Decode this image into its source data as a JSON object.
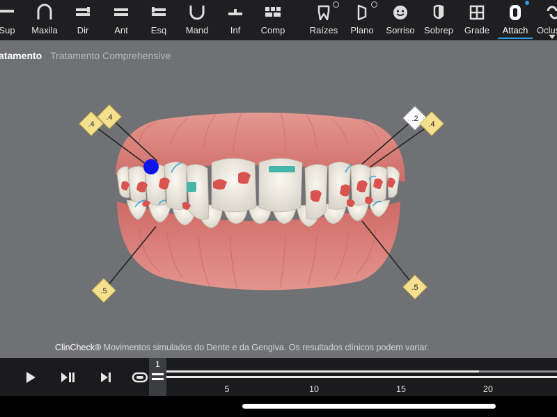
{
  "toolbar": {
    "items": [
      {
        "label": "Sup",
        "icon": "upper-jaw-view-icon"
      },
      {
        "label": "Maxila",
        "icon": "maxilla-icon"
      },
      {
        "label": "Dir",
        "icon": "right-view-icon"
      },
      {
        "label": "Ant",
        "icon": "anterior-view-icon"
      },
      {
        "label": "Esq",
        "icon": "left-view-icon"
      },
      {
        "label": "Mand",
        "icon": "mandible-icon"
      },
      {
        "label": "Inf",
        "icon": "lower-view-icon"
      },
      {
        "label": "Comp",
        "icon": "compare-grid-icon"
      },
      {
        "label": "Raízes",
        "icon": "tooth-root-icon"
      },
      {
        "label": "Plano",
        "icon": "occlusal-plane-icon"
      },
      {
        "label": "Sorriso",
        "icon": "smile-face-icon"
      },
      {
        "label": "Sobrep",
        "icon": "superimpose-icon"
      },
      {
        "label": "Grade",
        "icon": "grid-icon"
      },
      {
        "label": "Attach",
        "icon": "attachment-icon",
        "active": true
      },
      {
        "label": "Oclus",
        "icon": "occlusion-icon"
      }
    ],
    "accent_color": "#2f9be8"
  },
  "breadcrumb": {
    "current": "atamento",
    "subtitle": "Tratamento Comprehensive"
  },
  "markers": [
    {
      "label": ".4"
    },
    {
      "label": ".4"
    },
    {
      "label": ".2"
    },
    {
      "label": ".4"
    },
    {
      "label": ".5"
    },
    {
      "label": ".5"
    }
  ],
  "disclaimer": {
    "brand": "ClinCheck®",
    "text": " Movimentos simulados do Dente e da Gengiva. Os resultados clínicos podem variar."
  },
  "player": {
    "current_stage": "1",
    "ticks": [
      "5",
      "10",
      "15",
      "20"
    ],
    "progress_fraction": 0.8
  }
}
